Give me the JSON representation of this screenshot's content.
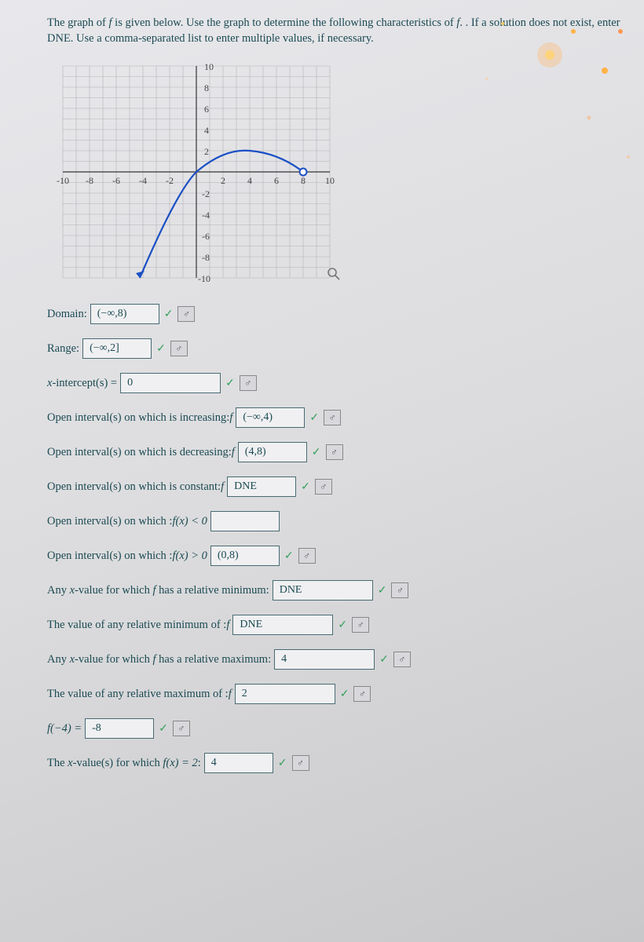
{
  "prompt": {
    "line1": "The graph of ",
    "fvar": "f",
    "line1b": " is given below. Use the graph to determine the following characteristics of ",
    "line1c": ". If a solution does not exist, enter DNE. Use a comma-separated list to enter multiple values, if necessary."
  },
  "chart_data": {
    "type": "line",
    "xlim": [
      -10,
      10
    ],
    "ylim": [
      -10,
      10
    ],
    "xticks": [
      -10,
      -8,
      -6,
      -4,
      -2,
      2,
      4,
      6,
      8,
      10
    ],
    "yticks": [
      -10,
      -8,
      -6,
      -4,
      -2,
      2,
      4,
      6,
      8,
      10
    ],
    "curve_desc": "Curve rising from lower-left, crossing (0,0), peaking at (4,2), then falling to open circle at (8,0)",
    "endpoints": {
      "left": {
        "type": "arrow",
        "x": -4.2,
        "y": -10
      },
      "right": {
        "type": "open",
        "x": 8,
        "y": 0
      }
    }
  },
  "rows": [
    {
      "label": "Domain:",
      "value": "(−∞,8)",
      "checked": true,
      "link": true
    },
    {
      "label": "Range:",
      "value": "(−∞,2]",
      "checked": true,
      "link": true
    },
    {
      "label_pre": "x",
      "label": "-intercept(s) =",
      "value": "0",
      "checked": true,
      "link": true,
      "wide": true
    },
    {
      "label": "Open interval(s) on which ",
      "fvar": "f",
      "label2": " is increasing:",
      "value": "(−∞,4)",
      "checked": true,
      "link": true
    },
    {
      "label": "Open interval(s) on which ",
      "fvar": "f",
      "label2": " is decreasing:",
      "value": "(4,8)",
      "checked": true,
      "link": true
    },
    {
      "label": "Open interval(s) on which ",
      "fvar": "f",
      "label2": " is constant:",
      "value": "DNE",
      "checked": true,
      "link": true
    },
    {
      "label": "Open interval(s) on which ",
      "fvar": "f(x) < 0",
      "label2": ":",
      "value": "",
      "checked": false,
      "link": false
    },
    {
      "label": "Open interval(s) on which ",
      "fvar": "f(x) > 0",
      "label2": ":",
      "value": "(0,8)",
      "checked": true,
      "link": true
    },
    {
      "label": "Any ",
      "xvar": "x",
      "label2": "-value for which ",
      "fvar": "f",
      "label3": " has a relative minimum:",
      "value": "DNE",
      "checked": true,
      "link": true,
      "wide": true
    },
    {
      "label": "The value of any relative minimum of ",
      "fvar": "f",
      "label2": ":",
      "value": "DNE",
      "checked": true,
      "link": true,
      "wide": true
    },
    {
      "label": "Any ",
      "xvar": "x",
      "label2": "-value for which ",
      "fvar": "f",
      "label3": " has a relative maximum:",
      "value": "4",
      "checked": true,
      "link": true,
      "wide": true
    },
    {
      "label": "The value of any relative maximum of ",
      "fvar": "f",
      "label2": ":",
      "value": "2",
      "checked": true,
      "link": true,
      "wide": true
    },
    {
      "fvar": "f(−4) =",
      "value": "-8",
      "checked": true,
      "link": true
    },
    {
      "label": "The ",
      "xvar": "x",
      "label2": "-value(s) for which ",
      "fvar": "f(x) = 2",
      "label3": ":",
      "value": "4",
      "checked": true,
      "link": true
    }
  ],
  "icons": {
    "check": "✓",
    "link": "♂"
  }
}
